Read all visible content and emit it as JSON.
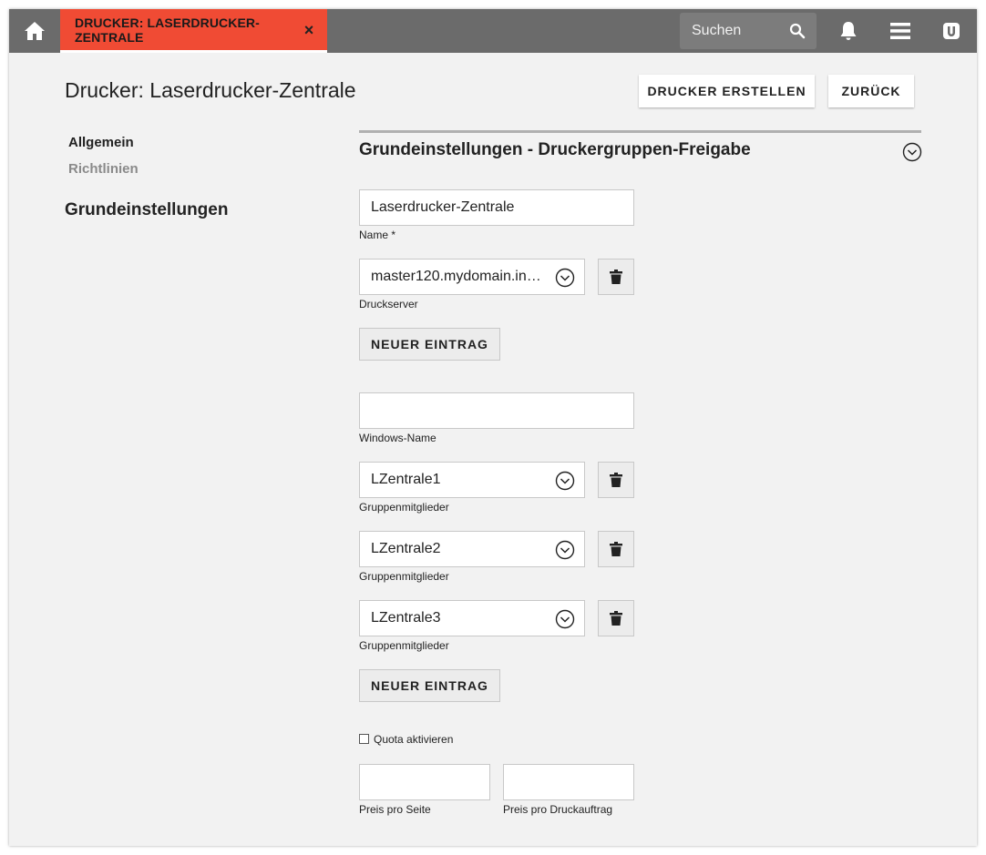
{
  "topbar": {
    "home_icon": "home-icon",
    "tab_label": "DRUCKER: LASERDRUCKER-ZENTRALE",
    "tab_close": "×",
    "search_placeholder": "Suchen",
    "icons": [
      "search-icon",
      "bell-icon",
      "menu-icon",
      "univention-logo-icon"
    ],
    "tab_color": "#f04b34",
    "bar_color": "#6b6b6b"
  },
  "header": {
    "title": "Drucker: Laserdrucker-Zentrale",
    "create_button": "DRUCKER ERSTELLEN",
    "back_button": "ZURÜCK"
  },
  "nav": {
    "items": [
      {
        "label": "Allgemein",
        "active": true
      },
      {
        "label": "Richtlinien",
        "active": false
      }
    ],
    "section_label": "Grundeinstellungen"
  },
  "section": {
    "title": "Grundeinstellungen - Druckergruppen-Freigabe"
  },
  "form": {
    "name": {
      "value": "Laserdrucker-Zentrale",
      "label": "Name *"
    },
    "druckserver": {
      "value": "master120.mydomain.int…",
      "label": "Druckserver"
    },
    "new_entry_1": "NEUER EINTRAG",
    "windows_name": {
      "value": "",
      "label": "Windows-Name"
    },
    "members": [
      {
        "value": "LZentrale1",
        "label": "Gruppenmitglieder"
      },
      {
        "value": "LZentrale2",
        "label": "Gruppenmitglieder"
      },
      {
        "value": "LZentrale3",
        "label": "Gruppenmitglieder"
      }
    ],
    "new_entry_2": "NEUER EINTRAG",
    "quota": {
      "label": "Quota aktivieren",
      "checked": false
    },
    "price_page": {
      "value": "",
      "label": "Preis pro Seite"
    },
    "price_job": {
      "value": "",
      "label": "Preis pro Druckauftrag"
    }
  }
}
